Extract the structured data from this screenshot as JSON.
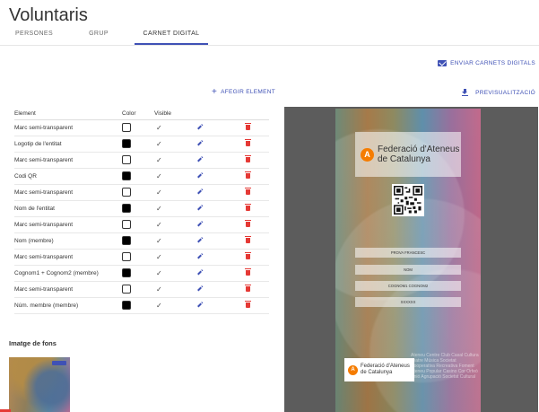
{
  "page": {
    "title": "Voluntaris"
  },
  "tabs": [
    {
      "label": "PERSONES",
      "active": false
    },
    {
      "label": "GRUP",
      "active": false
    },
    {
      "label": "CARNET DIGITAL",
      "active": true
    }
  ],
  "actions": {
    "send_label": "ENVIAR CARNETS DIGITALS",
    "add_label": "AFEGIR ELEMENT",
    "preview_label": "PREVISUALITZACIÓ"
  },
  "table": {
    "headers": {
      "element": "Element",
      "color": "Color",
      "visible": "Visible"
    },
    "rows": [
      {
        "element": "Marc semi-transparent",
        "color": "#ffffff",
        "visible": true
      },
      {
        "element": "Logotip de l'entitat",
        "color": "#000000",
        "visible": true
      },
      {
        "element": "Marc semi-transparent",
        "color": "#ffffff",
        "visible": true
      },
      {
        "element": "Codi QR",
        "color": "#000000",
        "visible": true
      },
      {
        "element": "Marc semi-transparent",
        "color": "#ffffff",
        "visible": true
      },
      {
        "element": "Nom de l'entitat",
        "color": "#000000",
        "visible": true
      },
      {
        "element": "Marc semi-transparent",
        "color": "#ffffff",
        "visible": true
      },
      {
        "element": "Nom (membre)",
        "color": "#000000",
        "visible": true
      },
      {
        "element": "Marc semi-transparent",
        "color": "#ffffff",
        "visible": true
      },
      {
        "element": "Cognom1 + Cognom2 (membre)",
        "color": "#000000",
        "visible": true
      },
      {
        "element": "Marc semi-transparent",
        "color": "#ffffff",
        "visible": true
      },
      {
        "element": "Núm. membre (membre)",
        "color": "#000000",
        "visible": true
      }
    ]
  },
  "background": {
    "label": "Imatge de fons"
  },
  "preview": {
    "org_logo_letter": "A",
    "org_name": "Federació d'Ateneus de Catalunya",
    "fields": [
      "PROVA FRANCESC",
      "NOM",
      "COGNOM1 COGNOM2",
      "XXXXXX"
    ],
    "bottom_org_name": "Federació d'Ateneus de Catalunya",
    "word_cloud": "Ateneu Centre Club Casal Cultura Teatre Música Societat Cooperativa Recreativa Foment Ateneu Popular Casino Cor Orfeó Unió Agrupació Societat Cultural"
  },
  "colors": {
    "accent": "#3f51b5",
    "delete": "#e53935"
  },
  "icons": {
    "send": "mail-icon",
    "add": "plus-icon",
    "preview": "download-icon",
    "visible": "check-icon",
    "edit": "pencil-icon",
    "delete": "trash-icon"
  }
}
